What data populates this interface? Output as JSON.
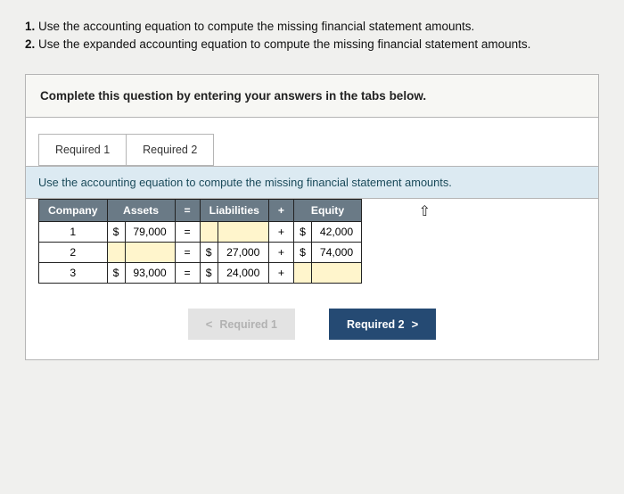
{
  "instructions": {
    "line1_num": "1.",
    "line1_text": " Use the accounting equation to compute the missing financial statement amounts.",
    "line2_num": "2.",
    "line2_text": " Use the expanded accounting equation to compute the missing financial statement amounts."
  },
  "panel": {
    "header_text": "Complete this question by entering your answers in the tabs below."
  },
  "tabs": {
    "tab1": "Required 1",
    "tab2": "Required 2"
  },
  "subheader": "Use the accounting equation to compute the missing financial statement amounts.",
  "chart_data": {
    "type": "table",
    "headers": {
      "company": "Company",
      "assets": "Assets",
      "eq_symbol": "=",
      "liabilities": "Liabilities",
      "plus_symbol": "+",
      "equity": "Equity"
    },
    "rows": [
      {
        "company": "1",
        "assets_currency": "$",
        "assets_value": "79,000",
        "op_eq": "=",
        "liabilities_currency": "",
        "liabilities_value": "",
        "op_plus": "+",
        "equity_currency": "$",
        "equity_value": "42,000"
      },
      {
        "company": "2",
        "assets_currency": "",
        "assets_value": "",
        "op_eq": "=",
        "liabilities_currency": "$",
        "liabilities_value": "27,000",
        "op_plus": "+",
        "equity_currency": "$",
        "equity_value": "74,000"
      },
      {
        "company": "3",
        "assets_currency": "$",
        "assets_value": "93,000",
        "op_eq": "=",
        "liabilities_currency": "$",
        "liabilities_value": "24,000",
        "op_plus": "+",
        "equity_currency": "",
        "equity_value": ""
      }
    ]
  },
  "nav": {
    "prev_chev": "<",
    "prev_label": "Required 1",
    "next_label": "Required 2",
    "next_chev": ">"
  }
}
